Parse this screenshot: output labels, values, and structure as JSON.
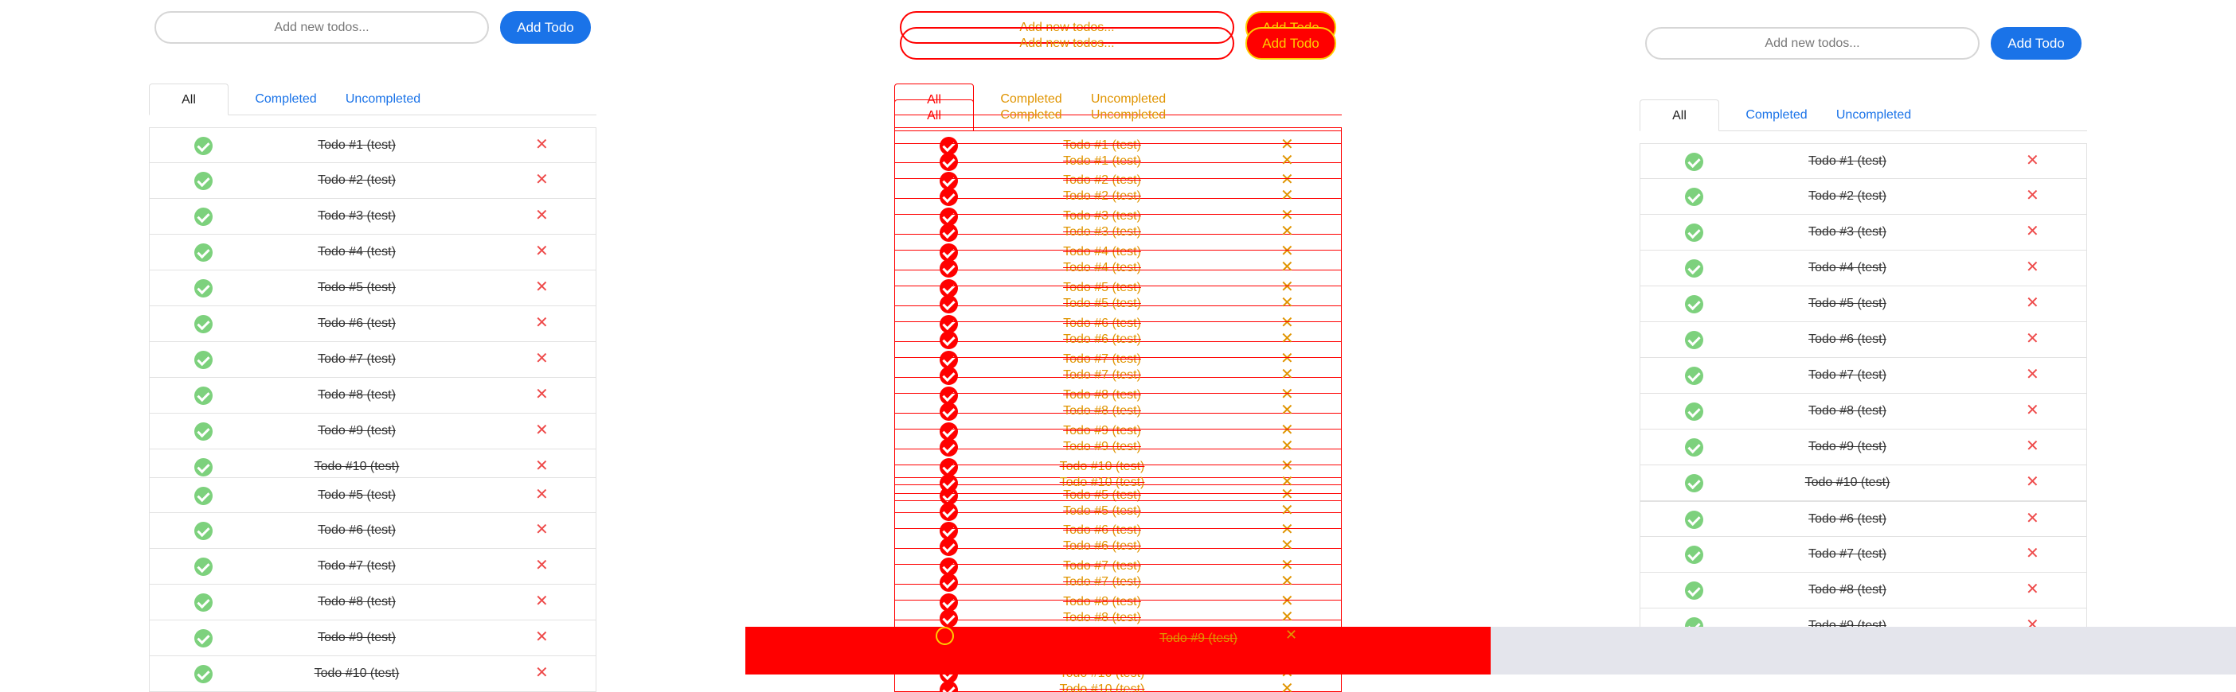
{
  "input": {
    "placeholder": "Add new todos..."
  },
  "add_button": {
    "label": "Add Todo"
  },
  "tabs": [
    {
      "label": "All"
    },
    {
      "label": "Completed"
    },
    {
      "label": "Uncompleted"
    }
  ],
  "todos_top": [
    {
      "text": "Todo #1 (test)"
    },
    {
      "text": "Todo #2 (test)"
    },
    {
      "text": "Todo #3 (test)"
    },
    {
      "text": "Todo #4 (test)"
    },
    {
      "text": "Todo #5 (test)"
    },
    {
      "text": "Todo #6 (test)"
    },
    {
      "text": "Todo #7 (test)"
    },
    {
      "text": "Todo #8 (test)"
    },
    {
      "text": "Todo #9 (test)"
    },
    {
      "text": "Todo #10 (test)"
    }
  ],
  "todos_bottom": [
    {
      "text": "Todo #5 (test)"
    },
    {
      "text": "Todo #6 (test)"
    },
    {
      "text": "Todo #7 (test)"
    },
    {
      "text": "Todo #8 (test)"
    },
    {
      "text": "Todo #9 (test)"
    },
    {
      "text": "Todo #10 (test)"
    }
  ],
  "todos_right_bottom": [
    {
      "text": "Todo #6 (test)"
    },
    {
      "text": "Todo #7 (test)"
    },
    {
      "text": "Todo #8 (test)"
    },
    {
      "text": "Todo #9 (test)"
    }
  ],
  "delete_icon": {
    "glyph": "✕"
  },
  "overlay_row": {
    "text": "Todo #9 (test)"
  },
  "colors": {
    "accent": "#1a73e8",
    "check": "#7dd17d",
    "delete": "#ee4b4b",
    "debug": "#ff0000"
  }
}
